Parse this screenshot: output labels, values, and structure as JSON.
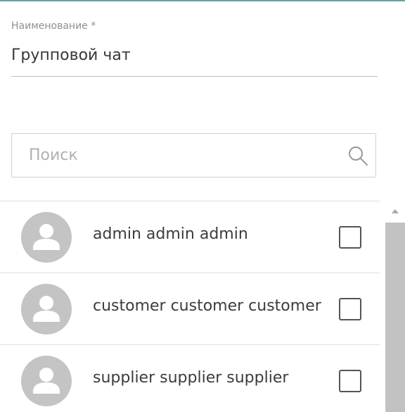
{
  "form": {
    "name_label": "Наименование *",
    "name_value": "Групповой чат"
  },
  "search": {
    "placeholder": "Поиск",
    "value": "",
    "icon": "search-icon"
  },
  "users": [
    {
      "name": "admin admin admin",
      "checked": false
    },
    {
      "name": "customer customer customer",
      "checked": false
    },
    {
      "name": "supplier supplier supplier",
      "checked": false
    }
  ],
  "colors": {
    "accent": "#5fa8a0",
    "avatar_bg": "#c4c4c4",
    "text": "#3c3c3c",
    "muted": "#8f8f8f"
  }
}
